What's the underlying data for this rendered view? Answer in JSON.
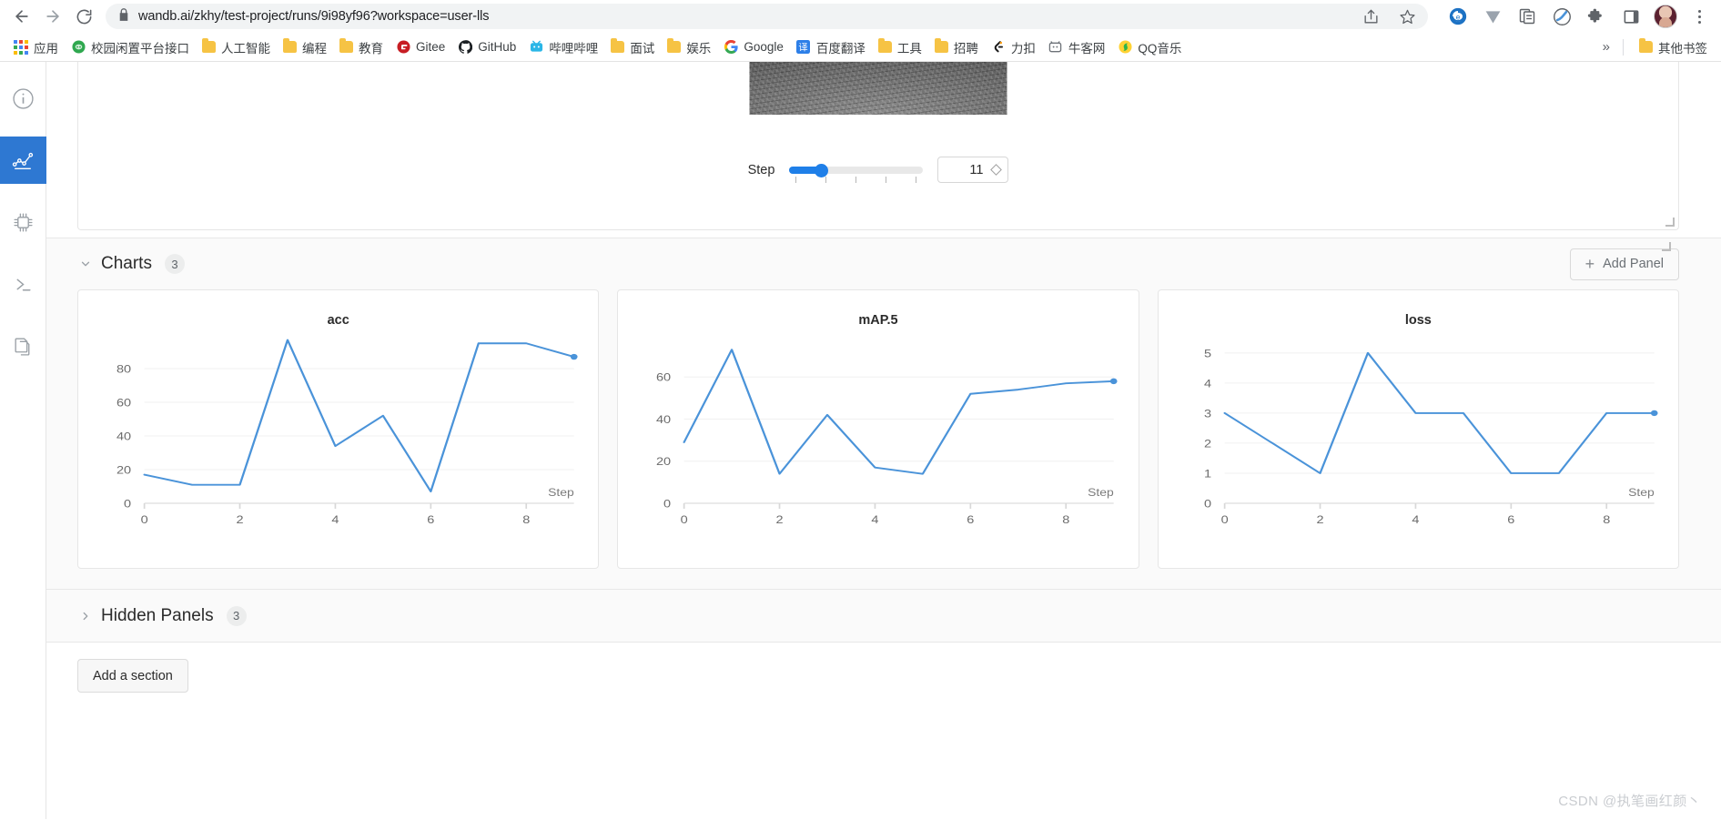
{
  "browser": {
    "back_icon": "back-arrow-icon",
    "forward_icon": "forward-arrow-icon",
    "reload_icon": "reload-icon",
    "lock_icon": "lock-icon",
    "url": "wandb.ai/zkhy/test-project/runs/9i98yf96?workspace=user-lls",
    "share_icon": "share-icon",
    "bookmark_star_icon": "star-icon",
    "extensions": [
      {
        "name": "ie-tab-extension-icon"
      },
      {
        "name": "vimium-extension-icon"
      },
      {
        "name": "clipboard-extension-icon"
      },
      {
        "name": "snowflake-extension-icon"
      },
      {
        "name": "puzzle-extensions-icon"
      },
      {
        "name": "side-panel-icon"
      }
    ],
    "profile_avatar": "profile-avatar",
    "menu_icon": "three-dot-menu-icon"
  },
  "bookmarks": {
    "apps_label": "应用",
    "items": [
      {
        "label": "校园闲置平台接口",
        "icon": "green-circle-favicon"
      },
      {
        "label": "人工智能",
        "icon": "folder-icon"
      },
      {
        "label": "编程",
        "icon": "folder-icon"
      },
      {
        "label": "教育",
        "icon": "folder-icon"
      },
      {
        "label": "Gitee",
        "icon": "gitee-favicon"
      },
      {
        "label": "GitHub",
        "icon": "github-favicon"
      },
      {
        "label": "哔哩哔哩",
        "icon": "bilibili-favicon"
      },
      {
        "label": "面试",
        "icon": "folder-icon"
      },
      {
        "label": "娱乐",
        "icon": "folder-icon"
      },
      {
        "label": "Google",
        "icon": "google-favicon"
      },
      {
        "label": "百度翻译",
        "icon": "baidu-translate-favicon"
      },
      {
        "label": "工具",
        "icon": "folder-icon"
      },
      {
        "label": "招聘",
        "icon": "folder-icon"
      },
      {
        "label": "力扣",
        "icon": "leetcode-favicon"
      },
      {
        "label": "牛客网",
        "icon": "nowcoder-favicon"
      },
      {
        "label": "QQ音乐",
        "icon": "qqmusic-favicon"
      }
    ],
    "overflow_label": "»",
    "other_bookmarks_label": "其他书签"
  },
  "rail": {
    "items": [
      {
        "name": "overview-info",
        "icon": "info-circle-icon",
        "active": false
      },
      {
        "name": "charts-workspace",
        "icon": "line-chart-icon",
        "active": true
      },
      {
        "name": "system-metrics",
        "icon": "cpu-chip-icon",
        "active": false
      },
      {
        "name": "logs-terminal",
        "icon": "terminal-prompt-icon",
        "active": false
      },
      {
        "name": "files",
        "icon": "copy-files-icon",
        "active": false
      }
    ]
  },
  "media_panel": {
    "step_label": "Step",
    "slider_value": 11,
    "slider_min": 0,
    "slider_max": 11,
    "slider_fill_percent": 24,
    "step_input_value": "11",
    "stepper_icon": "diamond-stepper-icon",
    "image_alt": "grayscale road scene"
  },
  "charts_section": {
    "collapse_icon": "chevron-down-icon",
    "title": "Charts",
    "count": "3",
    "add_panel_label": "Add Panel",
    "add_panel_icon": "plus-icon"
  },
  "hidden_section": {
    "expand_icon": "chevron-right-icon",
    "title": "Hidden Panels",
    "count": "3"
  },
  "footer": {
    "add_section_label": "Add a section",
    "watermark": "CSDN @执笔画红颜丶"
  },
  "theme": {
    "accent_blue": "#2e78d2",
    "line_blue": "#4a93d9",
    "slider_blue": "#1f7fe8",
    "panel_bg": "#fafafa",
    "border": "#e6e6e6"
  },
  "chart_data": [
    {
      "type": "line",
      "title": "acc",
      "xlabel": "Step",
      "ylabel": "",
      "x": [
        0,
        1,
        2,
        3,
        4,
        5,
        6,
        7,
        8,
        9
      ],
      "values": [
        17,
        11,
        11,
        97,
        34,
        52,
        7,
        95,
        95,
        87
      ],
      "xticks": [
        0,
        2,
        4,
        6,
        8
      ],
      "yticks": [
        0,
        20,
        40,
        60,
        80
      ],
      "xlim": [
        0,
        9
      ],
      "ylim": [
        0,
        100
      ],
      "grid": true,
      "legend": "none",
      "end_marker": true,
      "color": "#4a93d9"
    },
    {
      "type": "line",
      "title": "mAP.5",
      "xlabel": "Step",
      "ylabel": "",
      "x": [
        0,
        1,
        2,
        3,
        4,
        5,
        6,
        7,
        8,
        9
      ],
      "values": [
        29,
        73,
        14,
        42,
        17,
        14,
        52,
        54,
        57,
        58
      ],
      "xticks": [
        0,
        2,
        4,
        6,
        8
      ],
      "yticks": [
        0,
        20,
        40,
        60
      ],
      "xlim": [
        0,
        9
      ],
      "ylim": [
        0,
        80
      ],
      "grid": true,
      "legend": "none",
      "end_marker": true,
      "color": "#4a93d9"
    },
    {
      "type": "line",
      "title": "loss",
      "xlabel": "Step",
      "ylabel": "",
      "x": [
        0,
        1,
        2,
        3,
        4,
        5,
        6,
        7,
        8,
        9
      ],
      "values": [
        3,
        2,
        1,
        5,
        3,
        3,
        1,
        1,
        3,
        3
      ],
      "xticks": [
        0,
        2,
        4,
        6,
        8
      ],
      "yticks": [
        0,
        1,
        2,
        3,
        4,
        5
      ],
      "xlim": [
        0,
        9
      ],
      "ylim": [
        0,
        5.6
      ],
      "grid": true,
      "legend": "none",
      "end_marker": true,
      "color": "#4a93d9"
    }
  ]
}
